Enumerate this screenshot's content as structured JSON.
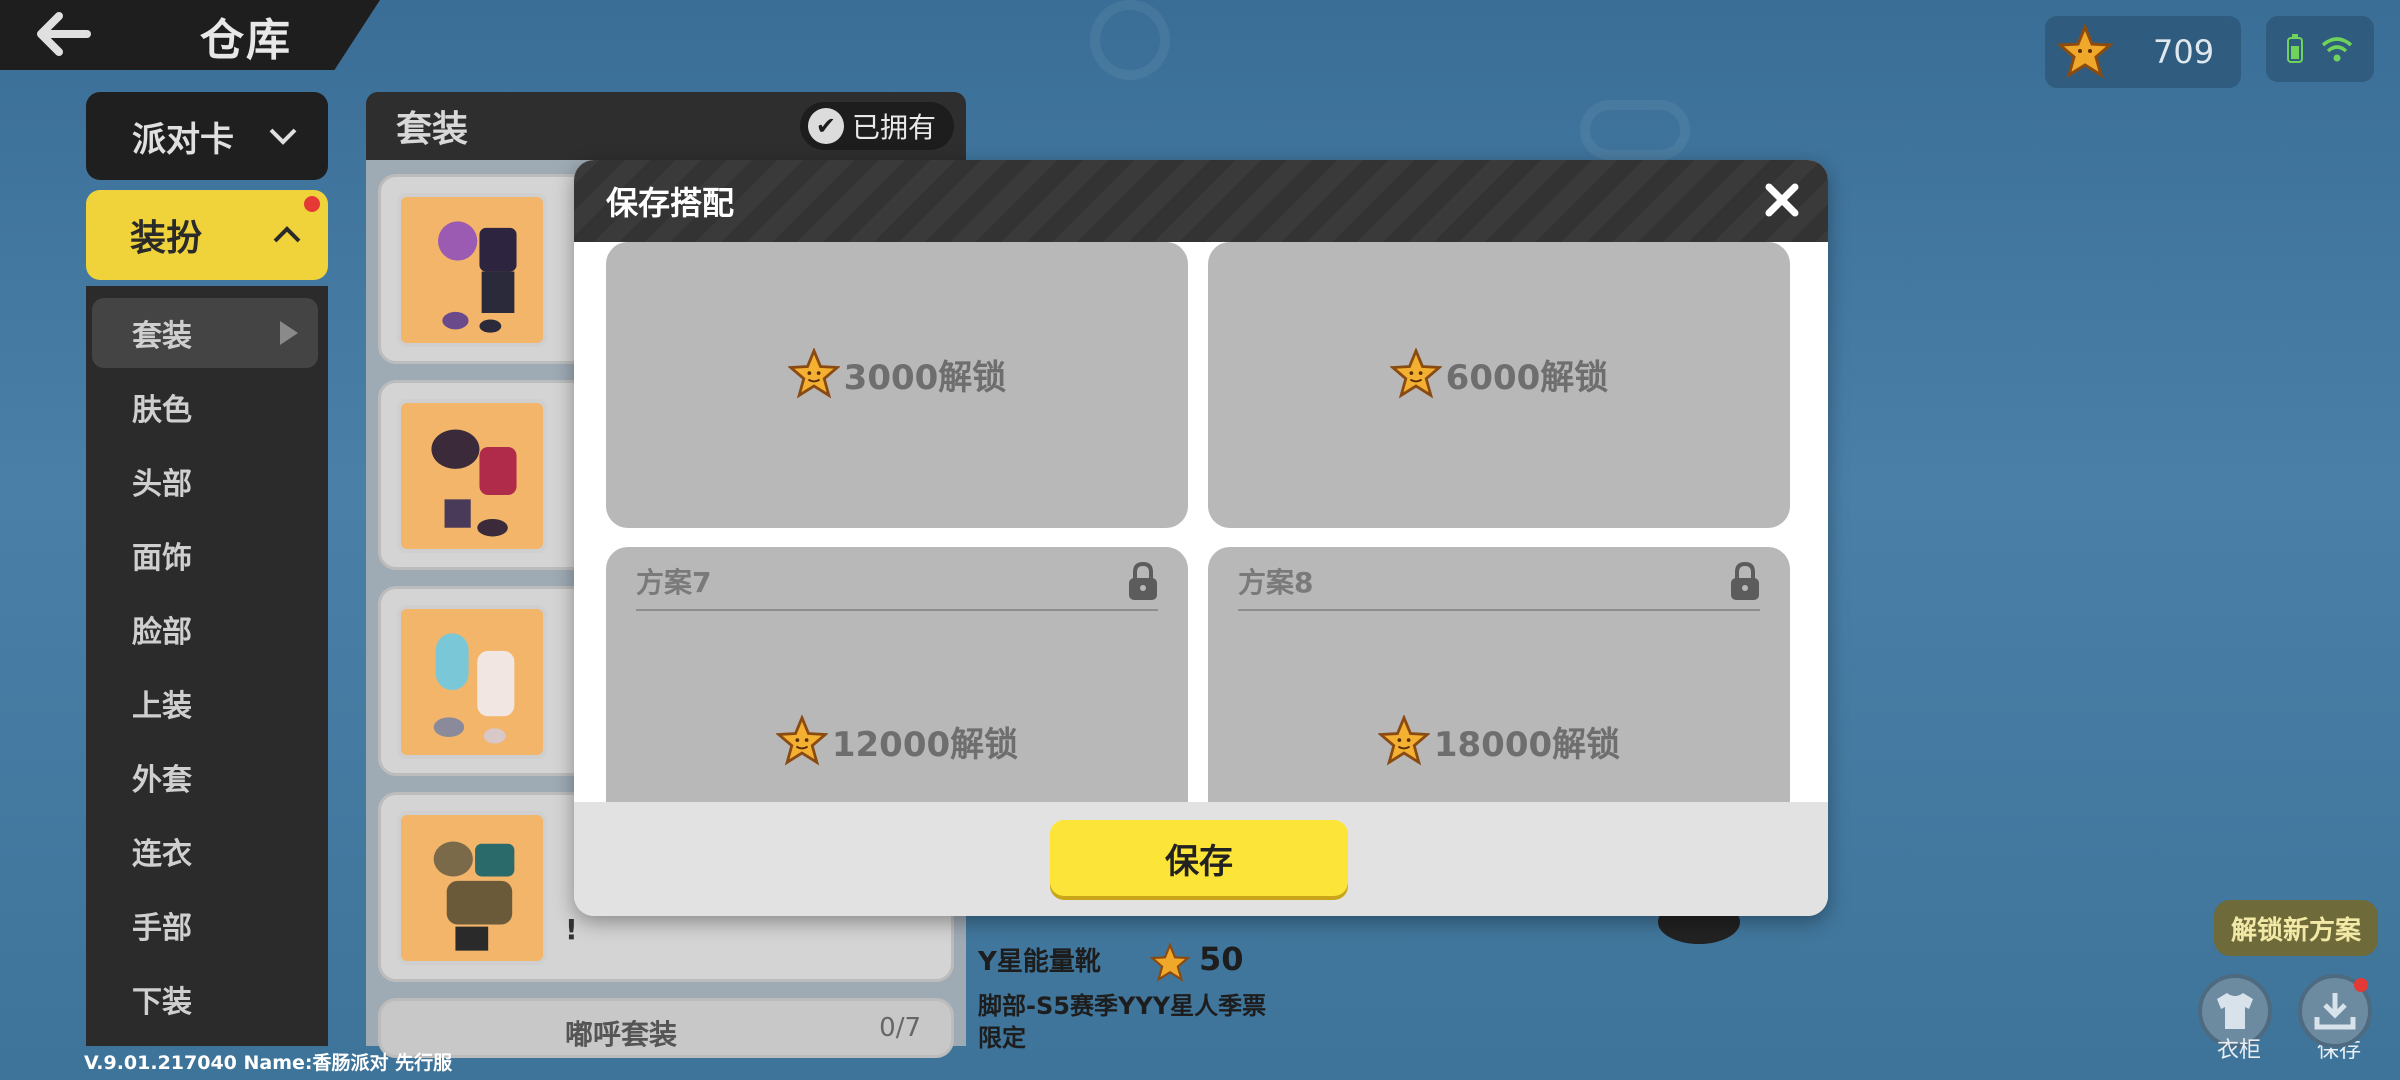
{
  "header": {
    "title": "仓库",
    "coins": "709"
  },
  "sidebar": {
    "party_card": "派对卡",
    "dress_up": "装扮",
    "items": [
      {
        "label": "套装"
      },
      {
        "label": "肤色"
      },
      {
        "label": "头部"
      },
      {
        "label": "面饰"
      },
      {
        "label": "脸部"
      },
      {
        "label": "上装"
      },
      {
        "label": "外套"
      },
      {
        "label": "连衣"
      },
      {
        "label": "手部"
      },
      {
        "label": "下装"
      }
    ]
  },
  "suit_panel": {
    "title": "套装",
    "owned_label": "已拥有",
    "partial_card": {
      "text": "嘟呼套装",
      "count": "0/7"
    },
    "partial_text": "!"
  },
  "item_info": {
    "name": "Y星能量靴",
    "price": "50",
    "desc": "脚部-S5赛季YYY星人季票限定"
  },
  "right_actions": {
    "unlock_new": "解锁新方案",
    "wardrobe": "衣柜",
    "save": "保存"
  },
  "modal": {
    "title": "保存搭配",
    "slots": [
      {
        "name": "",
        "price": "3000解锁"
      },
      {
        "name": "",
        "price": "6000解锁"
      },
      {
        "name": "方案7",
        "price": "12000解锁"
      },
      {
        "name": "方案8",
        "price": "18000解锁"
      }
    ],
    "save_button": "保存"
  },
  "version": "V.9.01.217040 Name:香肠派对 先行服"
}
